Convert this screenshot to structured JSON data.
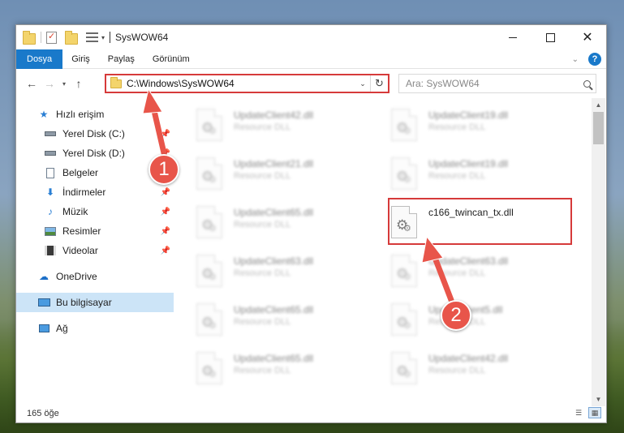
{
  "window": {
    "title": "SysWOW64",
    "controls": {
      "minimize": "—",
      "maximize": "☐",
      "close": "✕"
    }
  },
  "ribbon": {
    "tabs": [
      {
        "label": "Dosya",
        "active": true
      },
      {
        "label": "Giriş"
      },
      {
        "label": "Paylaş"
      },
      {
        "label": "Görünüm"
      }
    ],
    "help": "?"
  },
  "address": {
    "path": "C:\\Windows\\SysWOW64",
    "search_placeholder": "Ara: SysWOW64"
  },
  "sidebar": {
    "items": [
      {
        "label": "Hızlı erişim",
        "icon": "star-icon"
      },
      {
        "label": "Yerel Disk (C:)",
        "icon": "drive-icon",
        "pinned": true
      },
      {
        "label": "Yerel Disk (D:)",
        "icon": "drive-icon",
        "pinned": true
      },
      {
        "label": "Belgeler",
        "icon": "documents-icon",
        "pinned": true
      },
      {
        "label": "İndirmeler",
        "icon": "download-icon",
        "pinned": true
      },
      {
        "label": "Müzik",
        "icon": "music-icon",
        "pinned": true
      },
      {
        "label": "Resimler",
        "icon": "pictures-icon",
        "pinned": true
      },
      {
        "label": "Videolar",
        "icon": "videos-icon",
        "pinned": true
      },
      {
        "label": "OneDrive",
        "icon": "cloud-icon"
      },
      {
        "label": "Bu bilgisayar",
        "icon": "computer-icon",
        "selected": true
      },
      {
        "label": "Ağ",
        "icon": "network-icon"
      }
    ]
  },
  "files": {
    "left": [
      {
        "name": "UpdateClient42.dll",
        "type": "Resource DLL"
      },
      {
        "name": "UpdateClient21.dll",
        "type": "Resource DLL"
      },
      {
        "name": "UpdateClient65.dll",
        "type": "Resource DLL"
      },
      {
        "name": "UpdateClient63.dll",
        "type": "Resource DLL"
      },
      {
        "name": "UpdateClient65.dll",
        "type": "Resource DLL"
      },
      {
        "name": "UpdateClient65.dll",
        "type": "Resource DLL"
      }
    ],
    "right": [
      {
        "name": "UpdateClient19.dll",
        "type": "Resource DLL"
      },
      {
        "name": "UpdateClient19.dll",
        "type": "Resource DLL"
      },
      {
        "name": "c166_twincan_tx.dll",
        "type": "",
        "highlighted": true
      },
      {
        "name": "UpdateClient63.dll",
        "type": "Resource DLL"
      },
      {
        "name": "UpdateClient5.dll",
        "type": "Resource DLL"
      },
      {
        "name": "UpdateClient42.dll",
        "type": "Resource DLL"
      }
    ]
  },
  "status": {
    "count": "165 öğe"
  },
  "annotations": {
    "step1": "1",
    "step2": "2",
    "color": "#e8554a"
  }
}
